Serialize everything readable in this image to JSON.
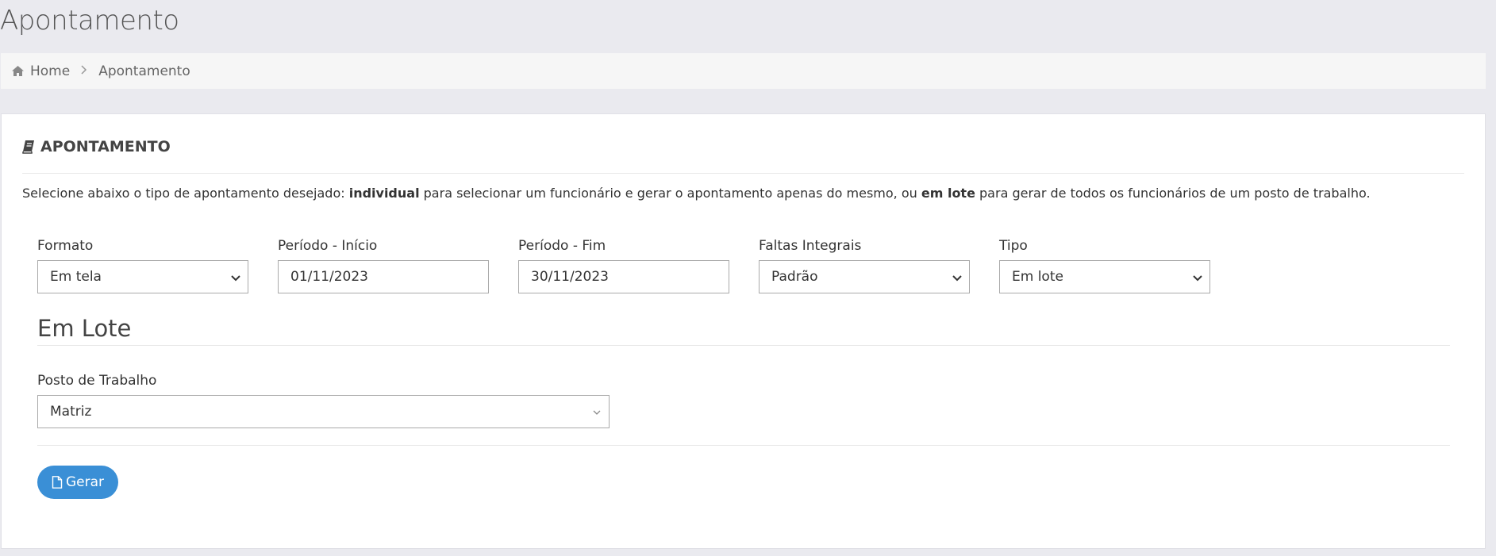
{
  "page": {
    "title": "Apontamento"
  },
  "breadcrumb": {
    "home": "Home",
    "current": "Apontamento"
  },
  "panel": {
    "heading": "APONTAMENTO",
    "intro": {
      "part1": "Selecione abaixo o tipo de apontamento desejado: ",
      "bold1": "individual",
      "part2": " para selecionar um funcionário e gerar o apontamento apenas do mesmo, ou ",
      "bold2": "em lote",
      "part3": " para gerar de todos os funcionários de um posto de trabalho."
    }
  },
  "form": {
    "formato": {
      "label": "Formato",
      "value": "Em tela"
    },
    "periodo_inicio": {
      "label": "Período - Início",
      "value": "01/11/2023"
    },
    "periodo_fim": {
      "label": "Período - Fim",
      "value": "30/11/2023"
    },
    "faltas": {
      "label": "Faltas Integrais",
      "value": "Padrão"
    },
    "tipo": {
      "label": "Tipo",
      "value": "Em lote"
    }
  },
  "lote": {
    "title": "Em Lote",
    "posto": {
      "label": "Posto de Trabalho",
      "value": "Matriz"
    }
  },
  "actions": {
    "gerar": "Gerar"
  },
  "colors": {
    "accent": "#3a8fd6",
    "background": "#eaeaef"
  },
  "icons": {
    "home": "home-icon",
    "book": "book-icon",
    "chevron": "chevron-down-icon",
    "file": "file-icon"
  }
}
